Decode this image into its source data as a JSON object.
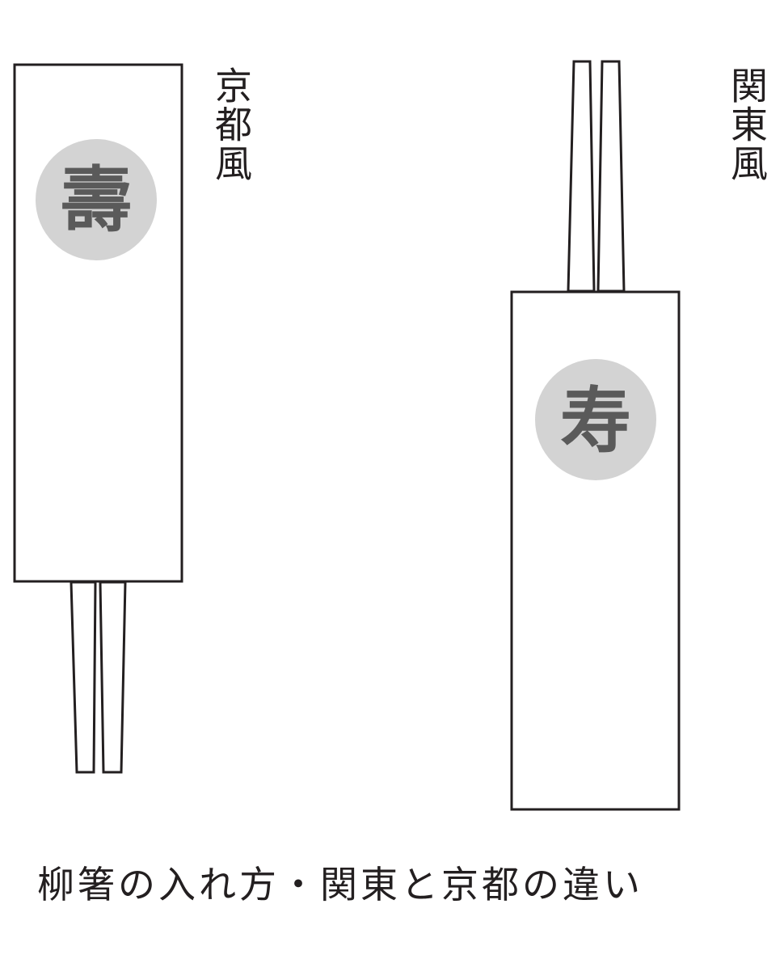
{
  "kyoto": {
    "label": "京都風",
    "envelope_char": "壽"
  },
  "kanto": {
    "label": "関東風",
    "envelope_char": "寿"
  },
  "caption": "柳箸の入れ方・関東と京都の違い",
  "colors": {
    "stroke": "#231f20",
    "seal": "#d3d3d3",
    "seal_text": "#5a5a5a"
  }
}
